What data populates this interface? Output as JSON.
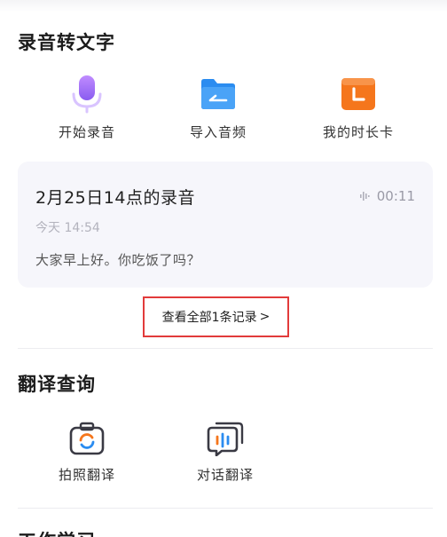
{
  "recording_section": {
    "title": "录音转文字",
    "tools": [
      {
        "label": "开始录音",
        "icon": "microphone-icon"
      },
      {
        "label": "导入音频",
        "icon": "folder-import-icon"
      },
      {
        "label": "我的时长卡",
        "icon": "clock-card-icon"
      }
    ]
  },
  "recent_record": {
    "title": "2月25日14点的录音",
    "duration": "00:11",
    "time": "今天 14:54",
    "transcript": "大家早上好。你吃饭了吗？"
  },
  "view_all": {
    "label": "查看全部1条记录",
    "arrow": ">"
  },
  "translate_section": {
    "title": "翻译查询",
    "tools": [
      {
        "label": "拍照翻译",
        "icon": "camera-translate-icon"
      },
      {
        "label": "对话翻译",
        "icon": "dialogue-translate-icon"
      }
    ]
  },
  "next_section": {
    "title": "工作学习"
  },
  "colors": {
    "accent_purple": "#a070f0",
    "accent_blue": "#2b8cf0",
    "accent_orange": "#f5761c",
    "highlight_red": "#e23b3b"
  }
}
